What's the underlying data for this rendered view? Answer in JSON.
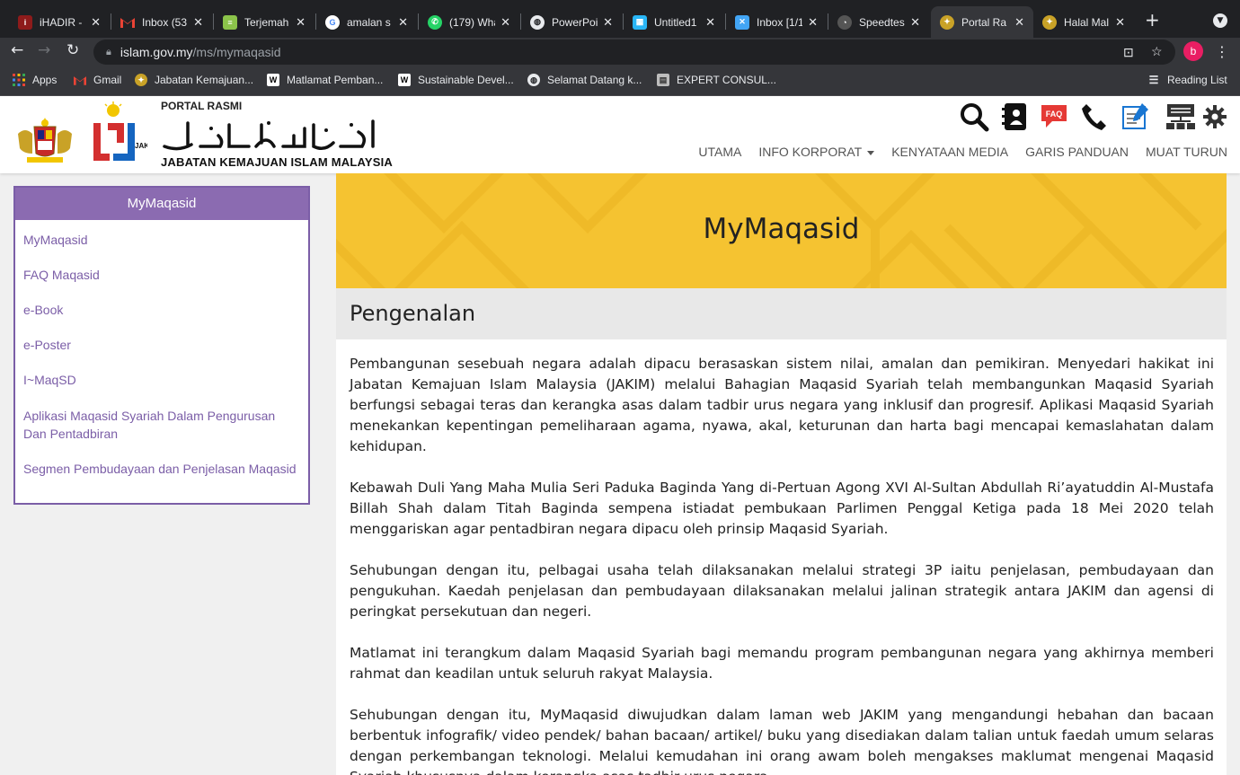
{
  "browser": {
    "tabs": [
      {
        "label": "iHADIR - ",
        "icon": "ihadir-icon",
        "color": "#8e1b1b"
      },
      {
        "label": "Inbox (53",
        "icon": "gmail-icon",
        "color": "#ffffff"
      },
      {
        "label": "Terjemah",
        "icon": "translate-icon",
        "color": "#4caf50"
      },
      {
        "label": "amalan s",
        "icon": "google-icon",
        "color": "#ffffff"
      },
      {
        "label": "(179) Wha",
        "icon": "whatsapp-icon",
        "color": "#25d366"
      },
      {
        "label": "PowerPoi",
        "icon": "globe-icon",
        "color": "#ffffff"
      },
      {
        "label": "Untitled1",
        "icon": "puzzle-icon",
        "color": "#29b6f6"
      },
      {
        "label": "Inbox [1/1",
        "icon": "mail-icon",
        "color": "#42a5f5"
      },
      {
        "label": "Speedtes",
        "icon": "speedometer-icon",
        "color": "#555555"
      },
      {
        "label": "Portal Ra",
        "icon": "crest-icon",
        "color": "#c9a227"
      },
      {
        "label": "Halal Mal",
        "icon": "crest-icon",
        "color": "#c9a227"
      }
    ],
    "active_tab_index": 9,
    "url_host": "islam.gov.my",
    "url_path": "/ms/mymaqasid",
    "profile_initial": "b",
    "bookmarks": [
      {
        "label": "Apps",
        "icon": "apps-grid-icon"
      },
      {
        "label": "Gmail",
        "icon": "gmail-icon"
      },
      {
        "label": "Jabatan Kemajuan...",
        "icon": "crest-icon"
      },
      {
        "label": "Matlamat Pemban...",
        "icon": "wikipedia-icon"
      },
      {
        "label": "Sustainable Devel...",
        "icon": "wikipedia-icon"
      },
      {
        "label": "Selamat Datang k...",
        "icon": "globe-icon"
      },
      {
        "label": "EXPERT CONSUL...",
        "icon": "document-icon"
      }
    ],
    "reading_list": "Reading List"
  },
  "site": {
    "portal_label": "PORTAL RASMI",
    "jakim_label": "JAKIM",
    "dept_name": "JABATAN KEMAJUAN ISLAM MALAYSIA",
    "faq_badge": "FAQ",
    "nav": [
      {
        "label": "UTAMA"
      },
      {
        "label": "INFO KORPORAT",
        "dropdown": true
      },
      {
        "label": "KENYATAAN MEDIA"
      },
      {
        "label": "GARIS PANDUAN"
      },
      {
        "label": "MUAT TURUN"
      }
    ],
    "sidebar": {
      "title": "MyMaqasid",
      "items": [
        "MyMaqasid",
        "FAQ Maqasid",
        "e-Book",
        "e-Poster",
        "I~MaqSD",
        "Aplikasi Maqasid Syariah Dalam Pengurusan Dan Pentadbiran",
        "Segmen Pembudayaan dan Penjelasan Maqasid"
      ]
    },
    "hero_title": "MyMaqasid",
    "section_title": "Pengenalan",
    "paragraphs": [
      "Pembangunan sesebuah negara adalah dipacu berasaskan sistem nilai, amalan dan pemikiran. Menyedari hakikat ini Jabatan Kemajuan Islam Malaysia (JAKIM) melalui Bahagian Maqasid Syariah telah membangunkan Maqasid Syariah berfungsi sebagai teras dan kerangka asas dalam tadbir urus negara yang inklusif dan progresif. Aplikasi Maqasid Syariah menekankan kepentingan pemeliharaan agama, nyawa, akal, keturunan dan harta bagi mencapai kemaslahatan dalam kehidupan.",
      "Kebawah Duli Yang Maha Mulia Seri Paduka Baginda Yang di-Pertuan Agong XVI Al-Sultan Abdullah Ri’ayatuddin Al-Mustafa Billah Shah dalam Titah Baginda sempena istiadat pembukaan Parlimen Penggal Ketiga pada 18 Mei 2020 telah menggariskan agar pentadbiran negara dipacu oleh prinsip Maqasid Syariah.",
      "Sehubungan dengan itu, pelbagai usaha telah dilaksanakan melalui strategi 3P iaitu penjelasan, pembudayaan dan pengukuhan. Kaedah penjelasan dan pembudayaan dilaksanakan melalui jalinan strategik antara JAKIM dan agensi di peringkat persekutuan dan negeri.",
      "Matlamat ini terangkum dalam Maqasid Syariah bagi memandu program pembangunan negara yang akhirnya memberi rahmat dan keadilan untuk seluruh rakyat Malaysia.",
      "Sehubungan dengan itu, MyMaqasid diwujudkan dalam laman web JAKIM yang mengandungi hebahan dan bacaan berbentuk infografik/ video pendek/ bahan bacaan/ artikel/ buku yang disediakan dalam talian untuk faedah umum selaras dengan perkembangan teknologi. Melalui kemudahan ini orang awam boleh mengakses maklumat mengenai Maqasid Syariah khususnya dalam kerangka asas tadbir urus negara."
    ]
  },
  "colors": {
    "accent_purple": "#8b6bb1",
    "link_purple": "#7b5ea7",
    "hero_yellow": "#f5c331",
    "jakim_red": "#d32f2f",
    "jakim_blue": "#1565c0"
  }
}
